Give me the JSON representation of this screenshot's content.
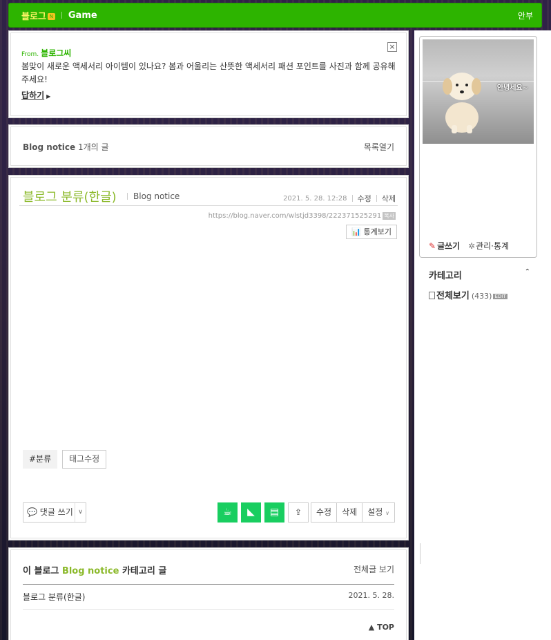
{
  "topbar": {
    "brand": "블로그",
    "badge": "N",
    "game": "Game",
    "help": "안부"
  },
  "message": {
    "from_prefix": "From.",
    "from_name": "블로그씨",
    "text": "봄맞이 새로운 액세서리 아이템이 있나요? 봄과 어울리는 산뜻한 액세서리 패션 포인트를 사진과 함께 공유해 주세요!",
    "reply": "답하기",
    "close": "×"
  },
  "notice": {
    "category": "Blog notice",
    "count": "1개의 글",
    "open": "목록열기"
  },
  "post": {
    "title": "블로그 분류(한글)",
    "category": "Blog notice",
    "date": "2021. 5. 28. 12:28",
    "edit": "수정",
    "delete": "삭제",
    "url": "https://blog.naver.com/wlstjd3398/222371525291",
    "copy": "복사",
    "stats": "통계보기",
    "tag": "#분류",
    "tag_edit": "태그수정",
    "comment": "댓글 쓰기",
    "btn_edit": "수정",
    "btn_delete": "삭제",
    "btn_settings": "설정"
  },
  "list": {
    "prefix": "이 블로그",
    "category": "Blog notice",
    "suffix": "카테고리 글",
    "all": "전체글 보기",
    "rows": [
      {
        "title": "블로그 분류(한글)",
        "date": "2021. 5. 28."
      }
    ],
    "top": "▲ TOP"
  },
  "profile": {
    "photo_caption": "안녕세요~",
    "write": "글쓰기",
    "admin": "관리·통계"
  },
  "category_box": {
    "title": "카테고리",
    "toggle": "⌃",
    "all": "전체보기",
    "count": "(433)",
    "edit": "EDIT"
  },
  "colors": {
    "brand_green": "#2db400",
    "title_green": "#8bb92a",
    "share_green": "#19ce60"
  }
}
